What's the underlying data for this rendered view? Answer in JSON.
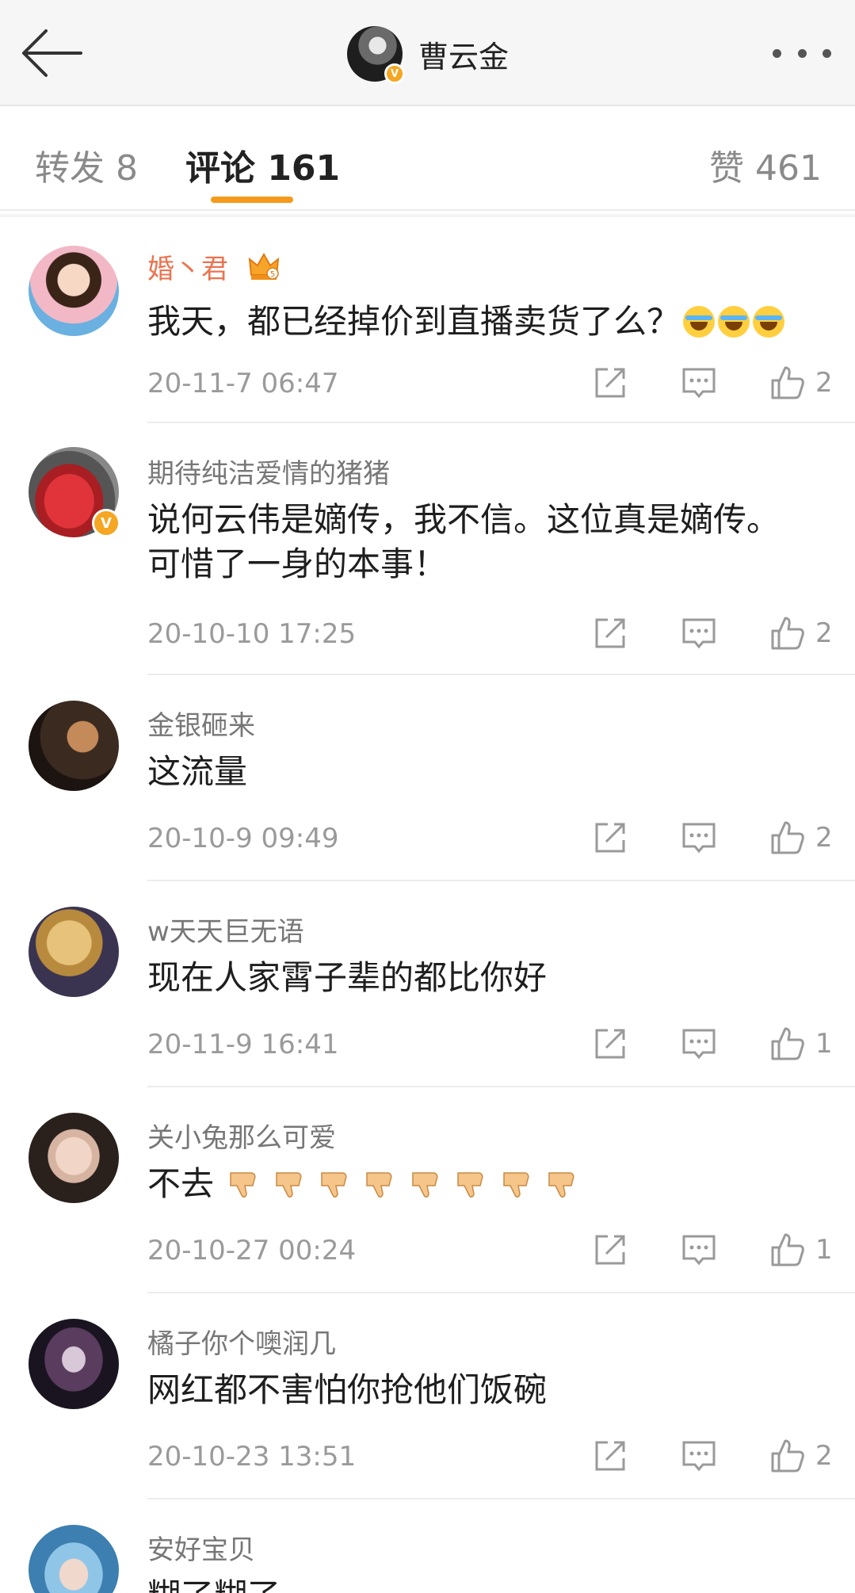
{
  "header": {
    "title": "曹云金",
    "verified_mark": "V"
  },
  "tabs": {
    "repost": "转发 8",
    "comments": "评论 161",
    "likes": "赞 461",
    "active_color": "#f59a1b"
  },
  "comments": [
    {
      "user": "婚丶君",
      "user_color": "#eb7350",
      "text": "我天，都已经掉价到直播卖货了么？",
      "emoji": [
        "laugh-cry",
        "laugh-cry",
        "laugh-cry"
      ],
      "crown_level": "5",
      "time": "20-11-7 06:47",
      "likes": "2"
    },
    {
      "user": "期待纯洁爱情的猪猪",
      "text_line1": "说何云伟是嫡传，我不信。这位真是嫡传。",
      "text_line2": "可惜了一身的本事！",
      "verified": "V",
      "time": "20-10-10 17:25",
      "likes": "2"
    },
    {
      "user": "金银砸来",
      "text": "这流量",
      "time": "20-10-9 09:49",
      "likes": "2"
    },
    {
      "user": "w天天巨无语",
      "text": "现在人家霄子辈的都比你好",
      "time": "20-11-9 16:41",
      "likes": "1"
    },
    {
      "user": "关小兔那么可爱",
      "text": "不去",
      "emoji": [
        "thumbs-down",
        "thumbs-down",
        "thumbs-down",
        "thumbs-down",
        "thumbs-down",
        "thumbs-down",
        "thumbs-down",
        "thumbs-down"
      ],
      "time": "20-10-27 00:24",
      "likes": "1"
    },
    {
      "user": "橘子你个噢润几",
      "text": "网红都不害怕你抢他们饭碗",
      "time": "20-10-23 13:51",
      "likes": "2"
    },
    {
      "user": "安好宝贝",
      "text": "糊了糊了"
    }
  ],
  "icons": {
    "back": "back-arrow-icon",
    "more": "more-dots-icon",
    "share": "share-icon",
    "comment": "comment-icon",
    "like": "thumbs-up-icon"
  }
}
